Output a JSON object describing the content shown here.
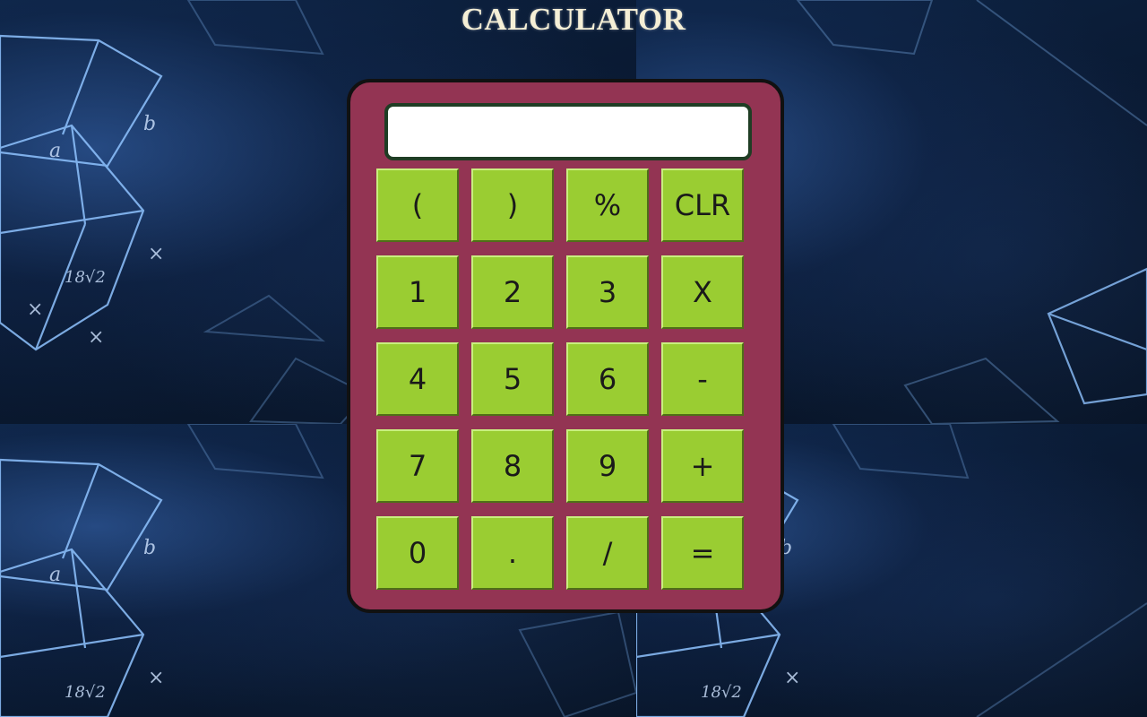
{
  "page": {
    "title": "CALCULATOR"
  },
  "display": {
    "value": ""
  },
  "keys": [
    {
      "label": "(",
      "name": "key-open-paren"
    },
    {
      "label": ")",
      "name": "key-close-paren"
    },
    {
      "label": "%",
      "name": "key-percent"
    },
    {
      "label": "CLR",
      "name": "key-clear"
    },
    {
      "label": "1",
      "name": "key-1"
    },
    {
      "label": "2",
      "name": "key-2"
    },
    {
      "label": "3",
      "name": "key-3"
    },
    {
      "label": "X",
      "name": "key-multiply"
    },
    {
      "label": "4",
      "name": "key-4"
    },
    {
      "label": "5",
      "name": "key-5"
    },
    {
      "label": "6",
      "name": "key-6"
    },
    {
      "label": "-",
      "name": "key-subtract"
    },
    {
      "label": "7",
      "name": "key-7"
    },
    {
      "label": "8",
      "name": "key-8"
    },
    {
      "label": "9",
      "name": "key-9"
    },
    {
      "label": "+",
      "name": "key-add"
    },
    {
      "label": "0",
      "name": "key-0"
    },
    {
      "label": ".",
      "name": "key-decimal"
    },
    {
      "label": "/",
      "name": "key-divide"
    },
    {
      "label": "=",
      "name": "key-equals"
    }
  ],
  "colors": {
    "calculator_body": "#933453",
    "key_fill": "#9acd32",
    "display_border": "#1f3d24",
    "title": "#f5efd6"
  }
}
